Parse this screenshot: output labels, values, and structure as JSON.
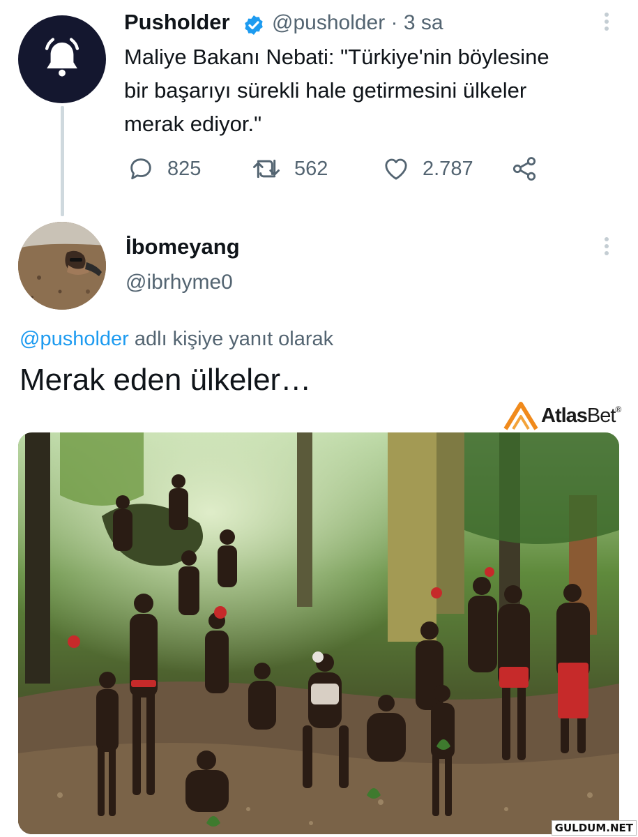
{
  "tweet": {
    "name": "Pusholder",
    "handle_time": "@pusholder · 3 sa",
    "text": "Maliye Bakanı Nebati: \"Türkiye'nin böylesine\nbir başarıyı sürekli hale getirmesini ülkeler\nmerak ediyor.\"",
    "replies": "825",
    "retweets": "562",
    "likes": "2.787",
    "avatar_icon": "bell-icon",
    "verified_color": "#1d9bf0"
  },
  "reply": {
    "name": "İbomeyang",
    "handle": "@ibrhyme0",
    "replying_mention": "@pusholder",
    "replying_suffix": " adlı kişiye yanıt olarak",
    "text": "Merak eden ülkeler…"
  },
  "watermark": {
    "brand_bold": "Atlas",
    "brand_light": "Bet",
    "reg": "®",
    "site": "GULDUM.NET"
  },
  "colors": {
    "link": "#1d9bf0",
    "muted": "#536471",
    "text": "#0f1419",
    "avatar_bg": "#14172f"
  }
}
